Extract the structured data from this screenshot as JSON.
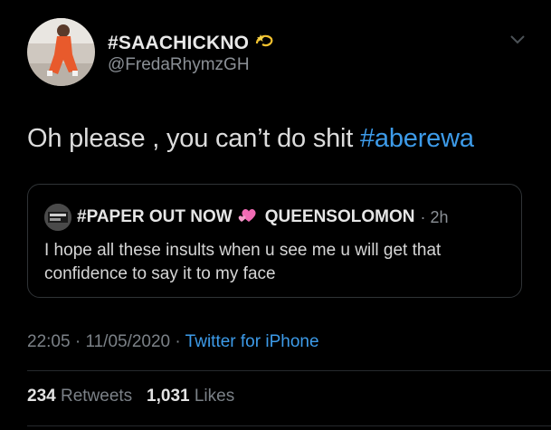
{
  "author": {
    "display_name": "#SAACHICKNO",
    "name_emoji": "dizzy-icon",
    "handle": "@FredaRhymzGH"
  },
  "tweet": {
    "text": "Oh please , you can’t do shit ",
    "hashtag": "#aberewa"
  },
  "quote": {
    "name_part1": "#PAPER OUT NOW",
    "name_emoji": "two-hearts-icon",
    "name_part2": "QUEENSOLOMON",
    "age": "· 2h",
    "text": "I hope all these insults when u see me u will get that confidence to say it to my face"
  },
  "meta": {
    "time": "22:05",
    "sep1": "·",
    "date": "11/05/2020",
    "sep2": "·",
    "source": "Twitter for iPhone"
  },
  "stats": {
    "retweets_count": "234",
    "retweets_label": "Retweets",
    "likes_count": "1,031",
    "likes_label": "Likes"
  },
  "colors": {
    "background": "#000000",
    "link": "#3d9be9",
    "secondary": "#8b9096"
  }
}
